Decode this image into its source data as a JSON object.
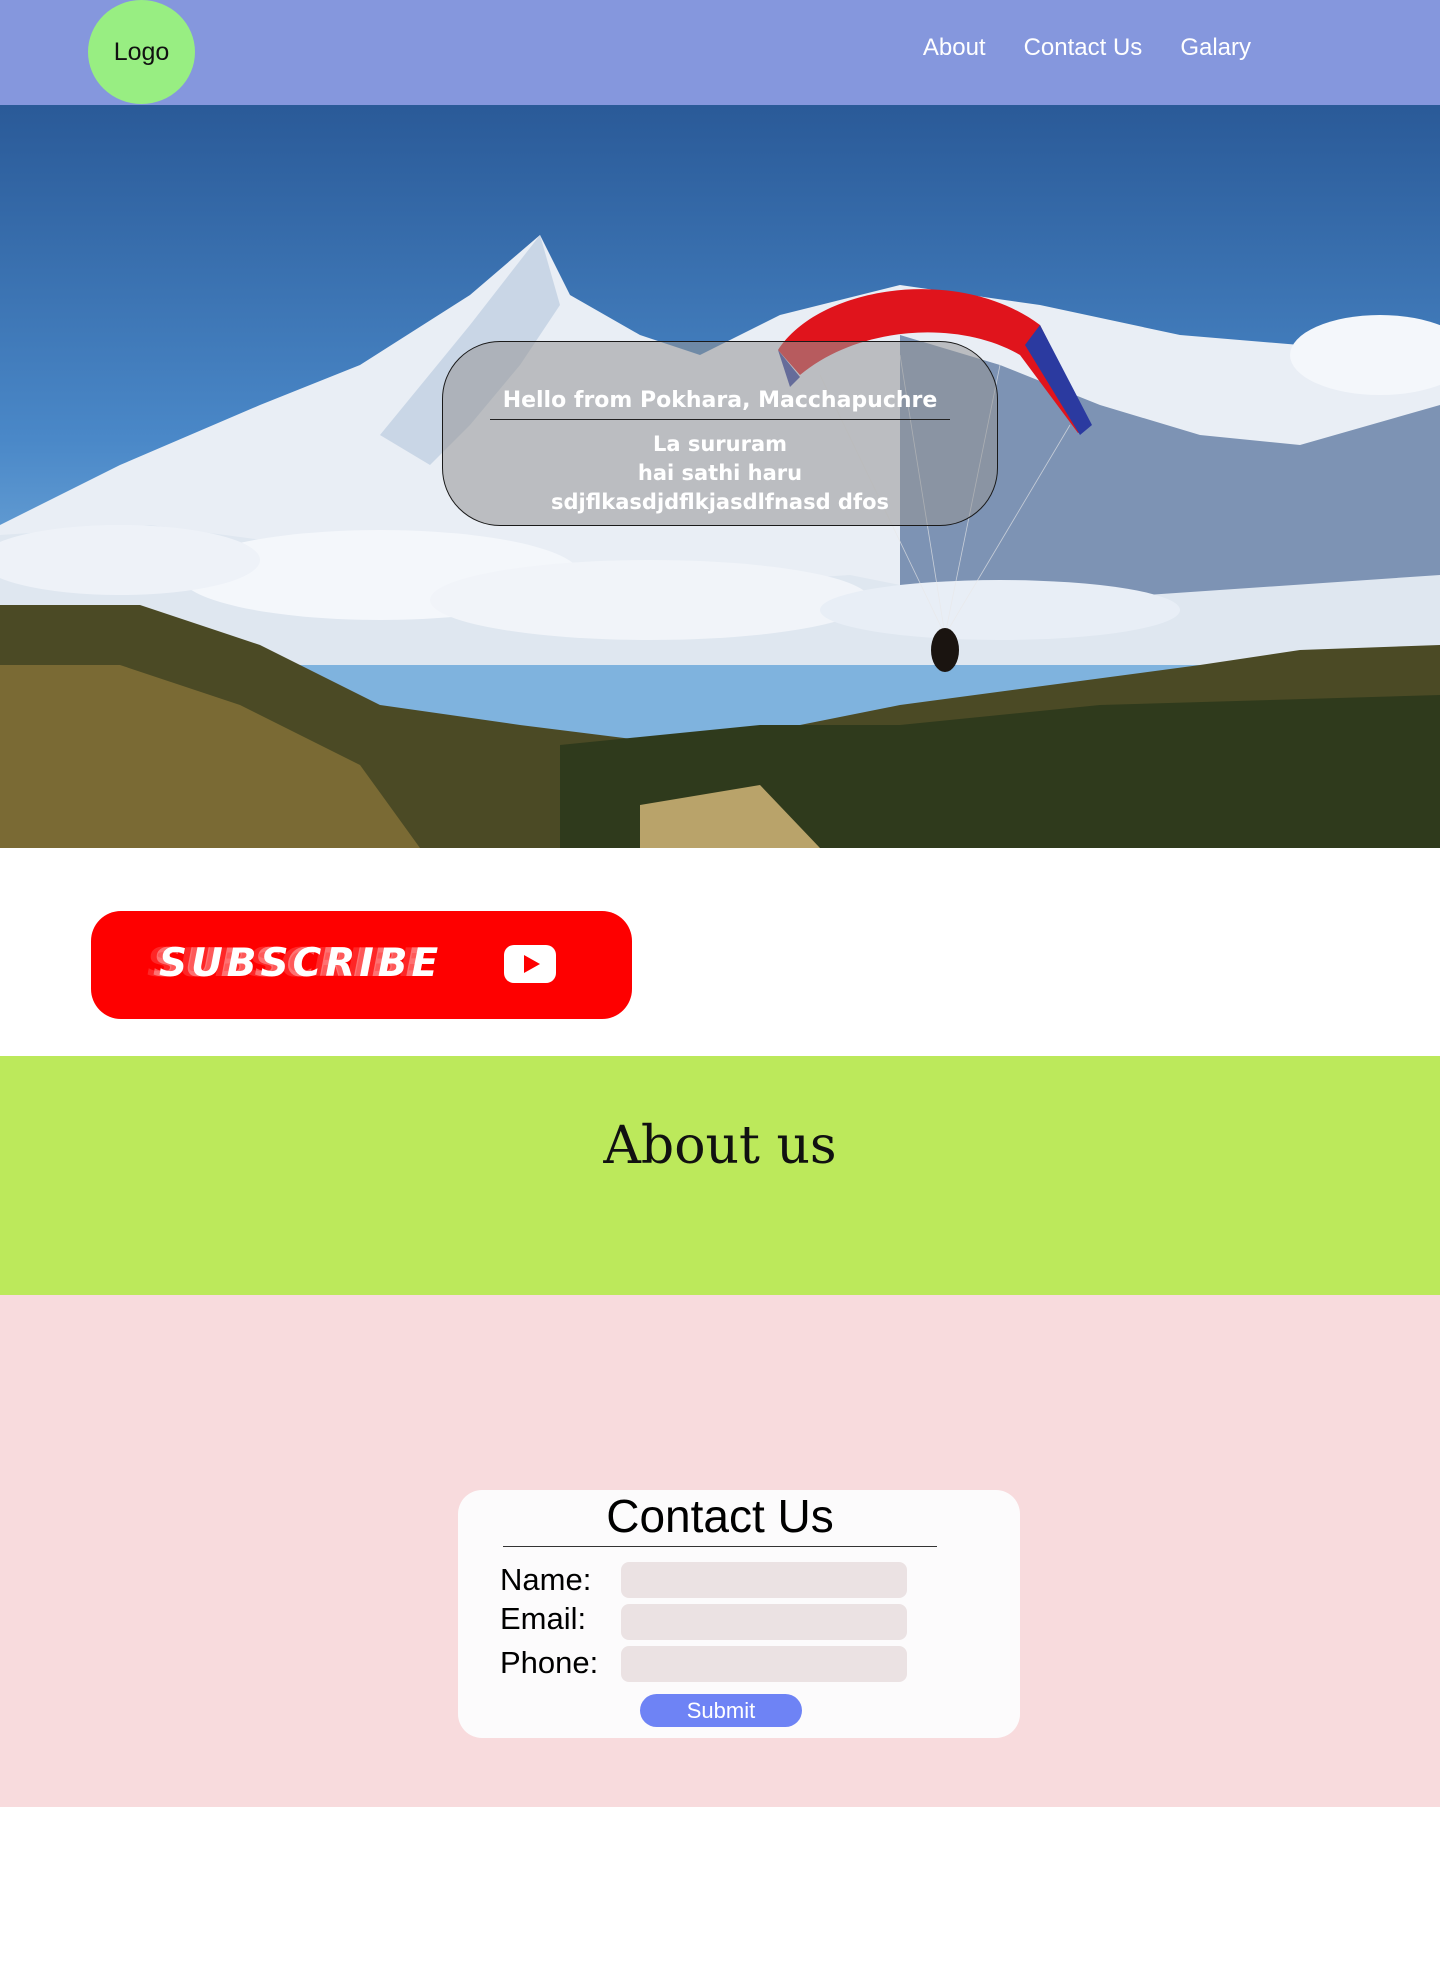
{
  "header": {
    "logo_text": "Logo",
    "nav": [
      "About",
      "Contact Us",
      "Galary"
    ]
  },
  "hero": {
    "title": "Hello from Pokhara, Macchapuchre",
    "lines": [
      "La sururam",
      "hai sathi haru",
      "sdjflkasdjdflkjasdlfnasd dfos"
    ]
  },
  "subscribe": {
    "label": "SUBSCRIBE",
    "icon": "youtube-play-icon"
  },
  "about": {
    "heading": "About us"
  },
  "contact": {
    "heading": "Contact Us",
    "fields": [
      {
        "label": "Name:",
        "value": ""
      },
      {
        "label": "Email:",
        "value": ""
      },
      {
        "label": "Phone:",
        "value": ""
      }
    ],
    "submit_label": "Submit"
  },
  "colors": {
    "header_bg": "#8597dd",
    "logo_bg": "#98ee82",
    "subscribe_bg": "#fe0000",
    "about_bg": "#bce95b",
    "contact_bg": "#f8dbdd",
    "submit_bg": "#6e83f5"
  }
}
